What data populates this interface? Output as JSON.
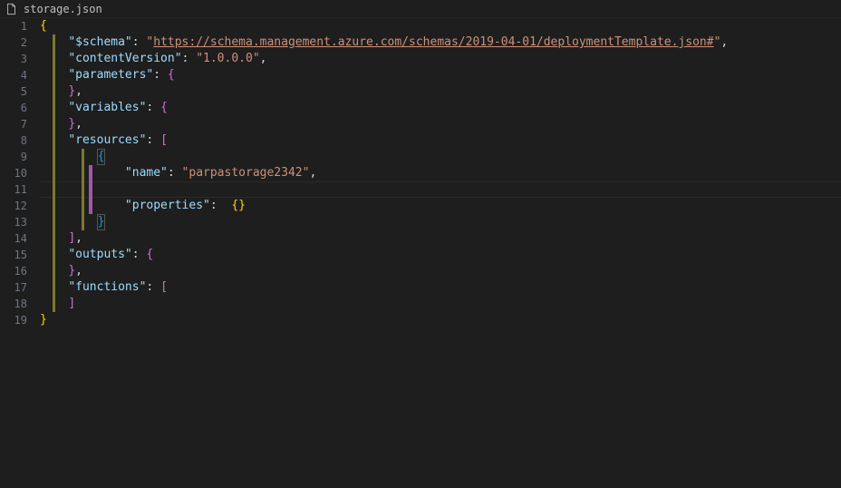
{
  "tab": {
    "filename": "storage.json"
  },
  "code": {
    "l1": "{",
    "l2_key": "\"$schema\"",
    "l2_sep": ": ",
    "l2_q": "\"",
    "l2_url": "https://schema.management.azure.com/schemas/2019-04-01/deploymentTemplate.json#",
    "l2_end": ",",
    "l3_key": "\"contentVersion\"",
    "l3_sep": ": ",
    "l3_val": "\"1.0.0.0\"",
    "l3_end": ",",
    "l4_key": "\"parameters\"",
    "l4_sep": ": ",
    "l4_brace": "{",
    "l5_close": "}",
    "l5_end": ",",
    "l6_key": "\"variables\"",
    "l6_sep": ": ",
    "l6_brace": "{",
    "l7_close": "}",
    "l7_end": ",",
    "l8_key": "\"resources\"",
    "l8_sep": ": ",
    "l8_bracket": "[",
    "l9_brace": "{",
    "l10_key": "\"name\"",
    "l10_sep": ": ",
    "l10_val": "\"parpastorage2342\"",
    "l10_end": ",",
    "l11": "",
    "l12_key": "\"properties\"",
    "l12_sep": ":  ",
    "l12_open": "{",
    "l12_close": "}",
    "l13_close": "}",
    "l14_close": "]",
    "l14_end": ",",
    "l15_key": "\"outputs\"",
    "l15_sep": ": ",
    "l15_brace": "{",
    "l16_close": "}",
    "l16_end": ",",
    "l17_key": "\"functions\"",
    "l17_sep": ": ",
    "l17_bracket": "[",
    "l18_close": "]",
    "l19": "}"
  },
  "lineNumbers": [
    "1",
    "2",
    "3",
    "4",
    "5",
    "6",
    "7",
    "8",
    "9",
    "10",
    "11",
    "12",
    "13",
    "14",
    "15",
    "16",
    "17",
    "18",
    "19"
  ]
}
